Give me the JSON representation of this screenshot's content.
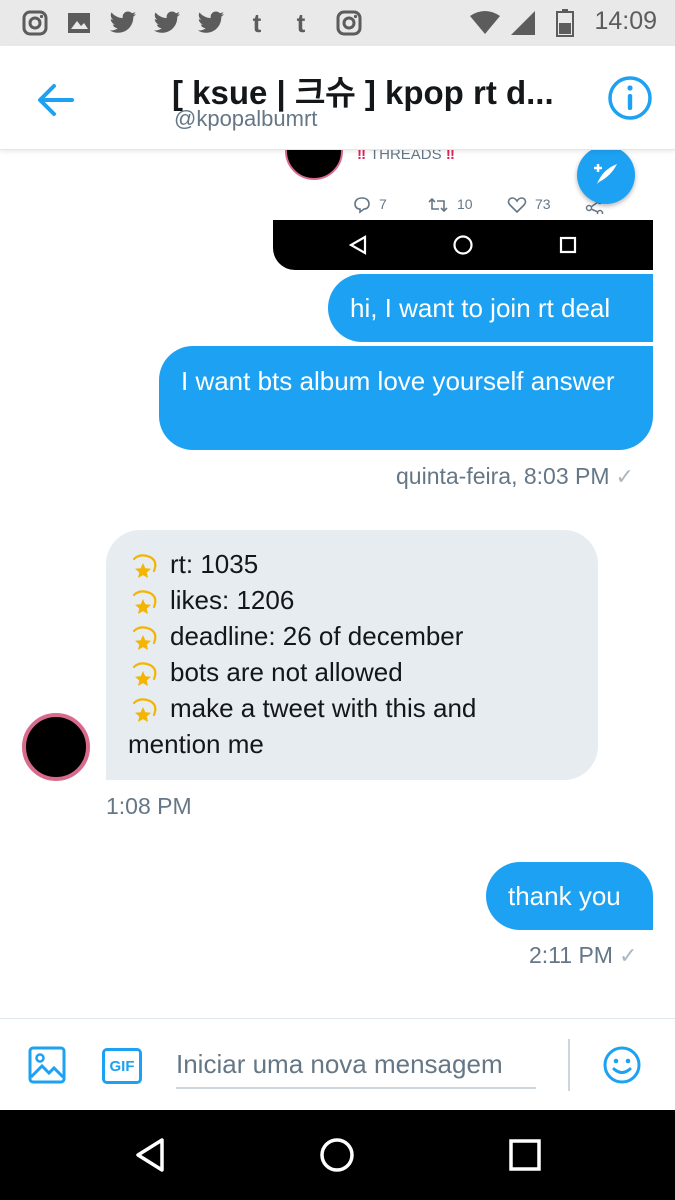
{
  "status_bar": {
    "time": "14:09",
    "notification_icons": [
      "instagram-icon",
      "image-icon",
      "twitter-icon",
      "twitter-icon",
      "twitter-icon",
      "tumblr-icon",
      "tumblr-icon",
      "instagram-icon"
    ],
    "tumblr_glyph": "t",
    "status_icons": [
      "wifi-icon",
      "signal-icon",
      "battery-icon"
    ]
  },
  "header": {
    "title": "[ ksue | 크슈 ] kpop rt d...",
    "handle": "@kpopalbumrt",
    "back_icon": "back-arrow-icon",
    "info_icon": "info-icon"
  },
  "embedded_tweet": {
    "text": "THREADS",
    "bang": "‼",
    "replies": "7",
    "retweets": "10",
    "likes": "73"
  },
  "messages": {
    "sent_1": "hi, I want to join rt deal",
    "sent_2": "I want bts album love yourself answer",
    "sent_2_meta": "quinta-feira, 8:03 PM",
    "received": {
      "lines": [
        "rt: 1035",
        "likes: 1206",
        "deadline: 26 of december",
        "bots are not allowed",
        "make a tweet with this and"
      ],
      "last_line": "mention me",
      "bullet_icon": "dizzy-star-icon",
      "meta": "1:08 PM"
    },
    "sent_3": "thank you",
    "sent_3_meta": "2:11 PM",
    "read_check": "✓"
  },
  "composer": {
    "placeholder": "Iniciar uma nova mensagem",
    "gif_label": "GIF",
    "image_icon": "image-icon",
    "emoji_icon": "emoji-icon"
  },
  "colors": {
    "accent": "#1da1f2",
    "received_bubble": "#e6ecf0",
    "meta_text": "#657786"
  }
}
